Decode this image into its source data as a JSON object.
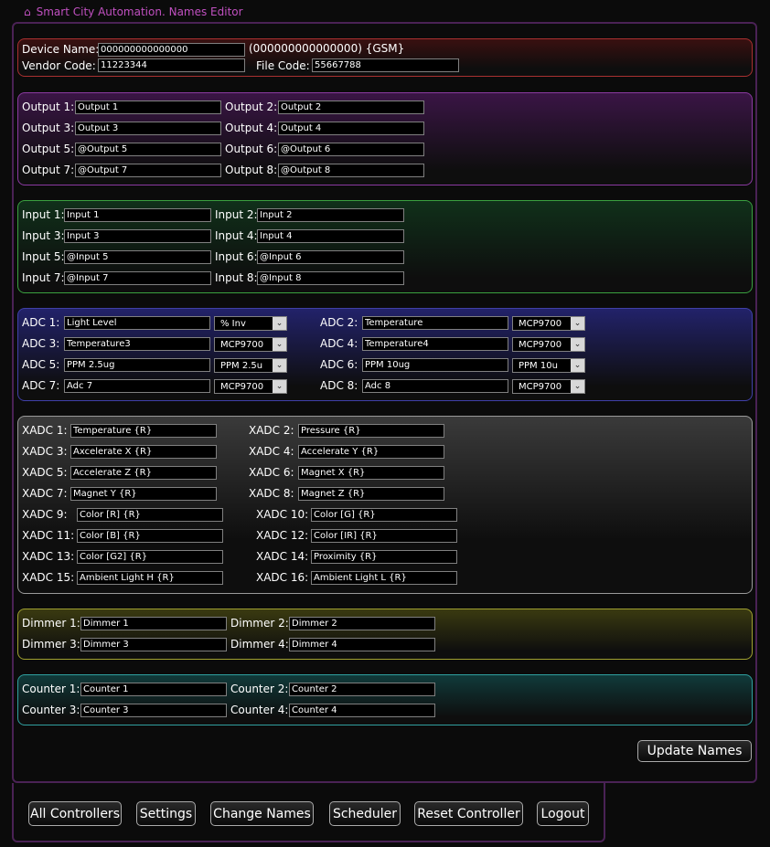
{
  "window": {
    "title": "Smart City Automation. Names Editor"
  },
  "device": {
    "name_label": "Device Name:",
    "name_value": "000000000000000",
    "suffix": "(000000000000000) {GSM}",
    "vendor_label": "Vendor Code:",
    "vendor_value": "11223344",
    "file_label": "File Code:",
    "file_value": "55667788"
  },
  "outputs": [
    {
      "label": "Output 1:",
      "value": "Output 1"
    },
    {
      "label": "Output 2:",
      "value": "Output 2"
    },
    {
      "label": "Output 3:",
      "value": "Output 3"
    },
    {
      "label": "Output 4:",
      "value": "Output 4"
    },
    {
      "label": "Output 5:",
      "value": "@Output 5"
    },
    {
      "label": "Output 6:",
      "value": "@Output 6"
    },
    {
      "label": "Output 7:",
      "value": "@Output 7"
    },
    {
      "label": "Output 8:",
      "value": "@Output 8"
    }
  ],
  "inputs": [
    {
      "label": "Input 1:",
      "value": "Input 1"
    },
    {
      "label": "Input 2:",
      "value": "Input 2"
    },
    {
      "label": "Input 3:",
      "value": "Input 3"
    },
    {
      "label": "Input 4:",
      "value": "Input 4"
    },
    {
      "label": "Input 5:",
      "value": "@Input 5"
    },
    {
      "label": "Input 6:",
      "value": "@Input 6"
    },
    {
      "label": "Input 7:",
      "value": "@Input 7"
    },
    {
      "label": "Input 8:",
      "value": "@Input 8"
    }
  ],
  "adcs": [
    {
      "label": "ADC 1:",
      "value": "Light Level",
      "type": "% Inv"
    },
    {
      "label": "ADC 2:",
      "value": "Temperature",
      "type": "MCP9700"
    },
    {
      "label": "ADC 3:",
      "value": "Temperature3",
      "type": "MCP9700"
    },
    {
      "label": "ADC 4:",
      "value": "Temperature4",
      "type": "MCP9700"
    },
    {
      "label": "ADC 5:",
      "value": "PPM 2.5ug",
      "type": "PPM 2.5u"
    },
    {
      "label": "ADC 6:",
      "value": "PPM 10ug",
      "type": "PPM 10u"
    },
    {
      "label": "ADC 7:",
      "value": "Adc 7",
      "type": "MCP9700"
    },
    {
      "label": "ADC 8:",
      "value": "Adc 8",
      "type": "MCP9700"
    }
  ],
  "xadcs": [
    {
      "label": "XADC 1:",
      "value": "Temperature {R}"
    },
    {
      "label": "XADC 2:",
      "value": "Pressure {R}"
    },
    {
      "label": "XADC 3:",
      "value": "Axcelerate X {R}"
    },
    {
      "label": "XADC 4:",
      "value": "Accelerate Y {R}"
    },
    {
      "label": "XADC 5:",
      "value": "Accelerate Z {R}"
    },
    {
      "label": "XADC 6:",
      "value": "Magnet X {R}"
    },
    {
      "label": "XADC 7:",
      "value": "Magnet Y {R}"
    },
    {
      "label": "XADC 8:",
      "value": "Magnet Z {R}"
    },
    {
      "label": "XADC 9:",
      "value": "Color [R] {R}"
    },
    {
      "label": "XADC 10:",
      "value": "Color [G] {R}"
    },
    {
      "label": "XADC 11:",
      "value": "Color [B] {R}"
    },
    {
      "label": "XADC 12:",
      "value": "Color [IR] {R}"
    },
    {
      "label": "XADC 13:",
      "value": "Color [G2] {R}"
    },
    {
      "label": "XADC 14:",
      "value": "Proximity {R}"
    },
    {
      "label": "XADC 15:",
      "value": "Ambient Light H {R}"
    },
    {
      "label": "XADC 16:",
      "value": "Ambient Light L {R}"
    }
  ],
  "dimmers": [
    {
      "label": "Dimmer 1:",
      "value": "Dimmer 1"
    },
    {
      "label": "Dimmer 2:",
      "value": "Dimmer 2"
    },
    {
      "label": "Dimmer 3:",
      "value": "Dimmer 3"
    },
    {
      "label": "Dimmer 4:",
      "value": "Dimmer 4"
    }
  ],
  "counters": [
    {
      "label": "Counter 1:",
      "value": "Counter 1"
    },
    {
      "label": "Counter 2:",
      "value": "Counter 2"
    },
    {
      "label": "Counter 3:",
      "value": "Counter 3"
    },
    {
      "label": "Counter 4:",
      "value": "Counter 4"
    }
  ],
  "update_label": "Update Names",
  "nav": [
    "All Controllers",
    "Settings",
    "Change Names",
    "Scheduler",
    "Reset Controller",
    "Logout"
  ],
  "icons": {
    "title": "home-icon",
    "select": "chevron-down-icon"
  }
}
